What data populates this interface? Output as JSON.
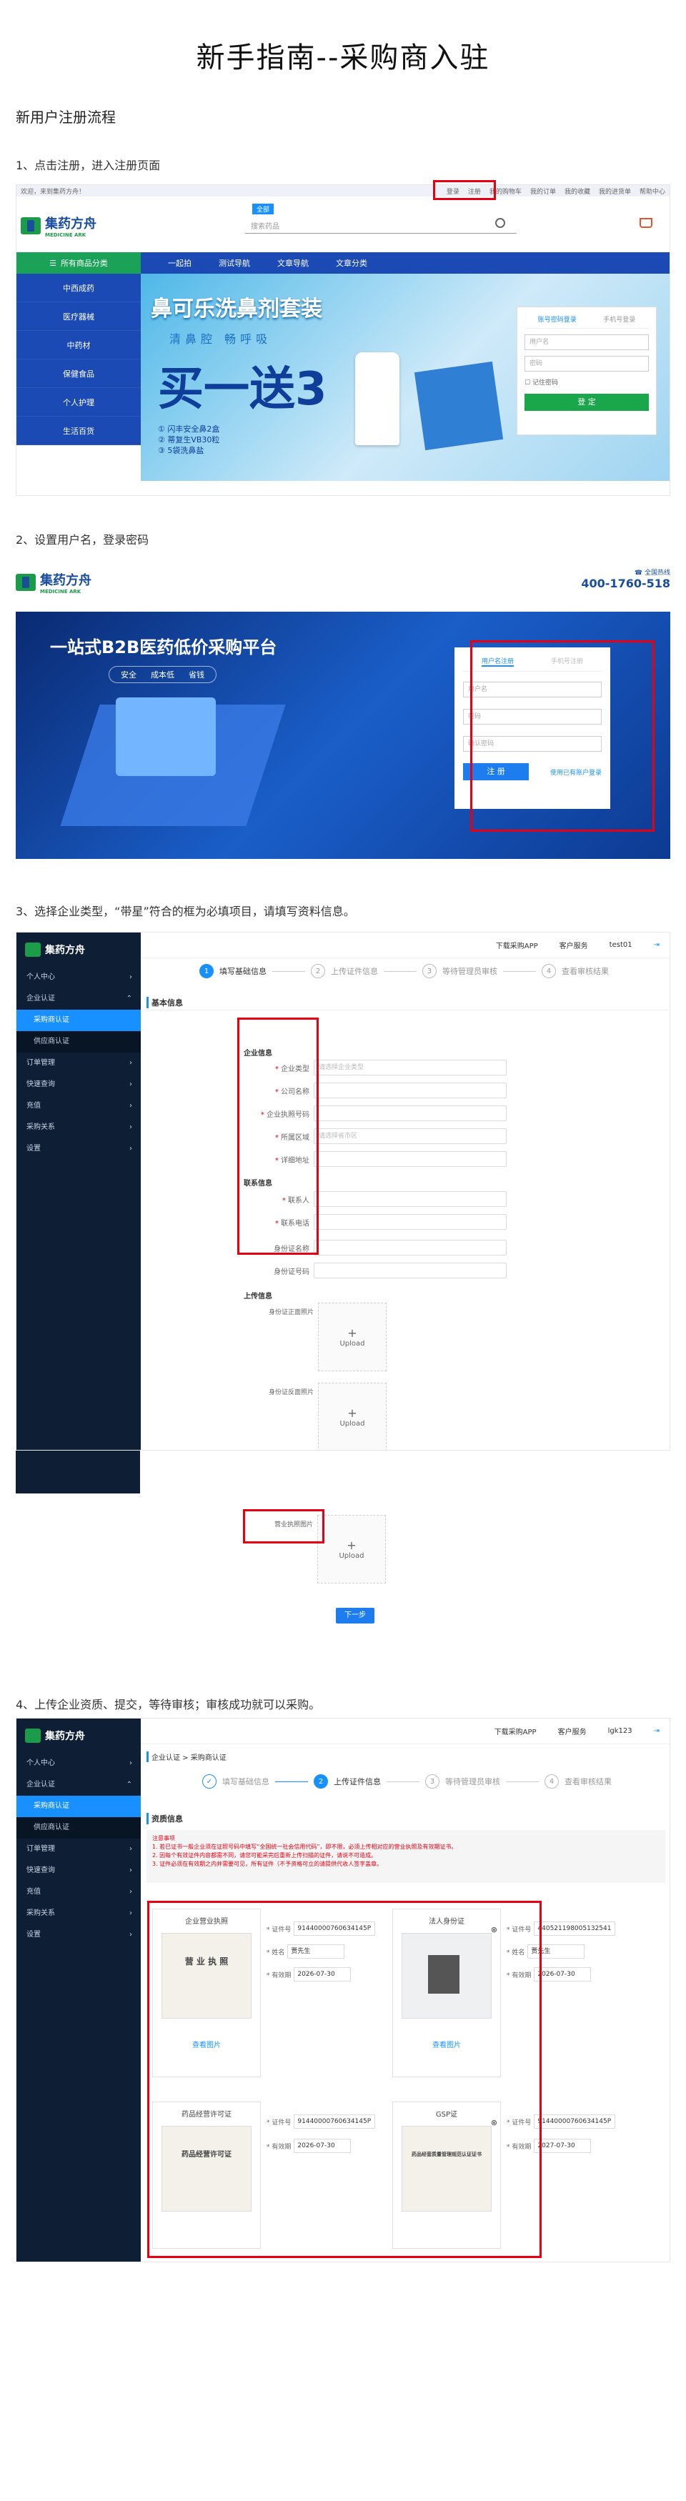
{
  "page": {
    "title": "新手指南--采购商入驻",
    "subtitle": "新用户注册流程"
  },
  "steps": [
    "1、点击注册，进入注册页面",
    "2、设置用户名，登录密码",
    "3、选择企业类型，“带星”符合的框为必填项目，请填写资料信息。",
    "4、上传企业资质、提交，等待审核；审核成功就可以采购。"
  ],
  "site": {
    "welcome": "欢迎，来到集药方舟！",
    "top_links": [
      "登录",
      "注册",
      "我的购物车",
      "我的订单",
      "我的收藏",
      "我的进货单",
      "帮助中心"
    ],
    "logo_cn": "集药方舟",
    "logo_en": "MEDICINE ARK",
    "search_tag": "全部",
    "search_placeholder": "搜索药品",
    "nav_category": "所有商品分类",
    "nav_items": [
      "一起拍",
      "测试导航",
      "文章导航",
      "文章分类"
    ],
    "side_categories": [
      "中西成药",
      "医疗器械",
      "中药材",
      "保健食品",
      "个人护理",
      "生活百货"
    ],
    "banner_title": "鼻可乐洗鼻剂套装",
    "banner_sub": "清鼻腔 畅呼吸",
    "banner_big": "买一送3",
    "banner_points": [
      "① 闪丰安全鼻2盒",
      "② 蒂复生VB30粒",
      "③ 5袋洗鼻盐"
    ],
    "login_tabs": [
      "账号密码登录",
      "手机号登录"
    ],
    "login_user": "用户名",
    "login_pwd": "密码",
    "remember": "记住密码",
    "login_btn": "登 定"
  },
  "register": {
    "hotline_label": "全国热线",
    "hotline": "400-1760-518",
    "banner_title": "一站式B2B医药低价采购平台",
    "banner_tags": [
      "安全",
      "成本低",
      "省钱"
    ],
    "tabs": [
      "用户名注册",
      "手机号注册"
    ],
    "username": "用户名",
    "password": "密码",
    "confirm": "确认密码",
    "submit": "注 册",
    "login_link": "使用已有账户登录"
  },
  "admin": {
    "logo": "集药方舟",
    "header_links": [
      "下载采购APP",
      "客户服务",
      "test01"
    ],
    "header_links2": [
      "下载采购APP",
      "客户服务",
      "lgk123"
    ],
    "menu": [
      "个人中心",
      "企业认证",
      "采购商认证",
      "供应商认证",
      "订单管理",
      "快速查询",
      "充值",
      "采购关系",
      "设置"
    ],
    "steps": [
      "填写基础信息",
      "上传证件信息",
      "等待管理员审核",
      "查看审核结果"
    ],
    "section": "基本信息",
    "group1": "企业信息",
    "group2": "联系信息",
    "group3": "上传信息",
    "fields": [
      {
        "label": "企业类型",
        "value": "请选择企业类型",
        "req": true
      },
      {
        "label": "公司名称",
        "value": "",
        "req": true
      },
      {
        "label": "企业执照号码",
        "value": "",
        "req": true
      },
      {
        "label": "所属区域",
        "value": "请选择省市区",
        "req": true
      },
      {
        "label": "详细地址",
        "value": "",
        "req": true
      }
    ],
    "contact": [
      {
        "label": "联系人",
        "value": "",
        "req": true
      },
      {
        "label": "联系电话",
        "value": "",
        "req": true
      },
      {
        "label": "身份证名称",
        "value": "",
        "req": false
      },
      {
        "label": "身份证号码",
        "value": "",
        "req": false
      }
    ],
    "uploads": [
      "身份证正面照片",
      "身份证反面照片",
      "营业执照图片"
    ],
    "upload_text": "Upload",
    "next": "下一步"
  },
  "qual": {
    "breadcrumb": "企业认证 > 采购商认证",
    "section": "资质信息",
    "notice_title": "注意事项",
    "notice": [
      "1. 若已证书一般企业须在证照号码中填写“全国统一社会信用代码”，即不限，必须上传相对应的营业执照及有效期证书。",
      "2. 因每个有效证件内容都需不同，请您可能采完后重新上传扫描的证件，请说不可造成。",
      "3. 证件必须在有效期之内并需要可见，所有证件（不予资格可立的请提供代收人签字盖章。"
    ],
    "cards": [
      {
        "title": "企业营业执照",
        "no": "91440000760634145P",
        "name": "贾先生",
        "date": "2026-07-30",
        "doc": "营 业 执 照"
      },
      {
        "title": "法人身份证",
        "no": "440521198005132541",
        "name": "贾先生",
        "date": "2026-07-30",
        "doc": ""
      },
      {
        "title": "药品经营许可证",
        "no": "91440000760634145P",
        "name": "",
        "date": "2026-07-30",
        "doc": "药品经营许可证"
      },
      {
        "title": "GSP证",
        "no": "91440000760634145P",
        "name": "",
        "date": "2027-07-30",
        "doc": "药品经营质量管理规范认证证书"
      }
    ],
    "labels": {
      "no": "证件号",
      "name": "姓名",
      "date": "有效期"
    },
    "view": "查看图片"
  }
}
